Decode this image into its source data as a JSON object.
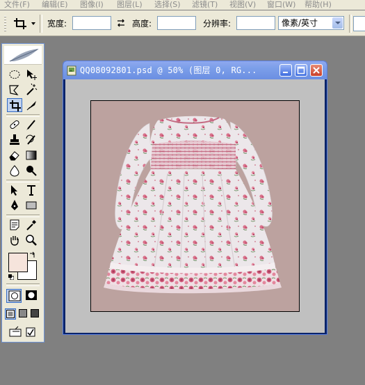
{
  "menu": [
    "文件(F)",
    "编辑(E)",
    "图像(I)",
    "图层(L)",
    "选择(S)",
    "滤镜(T)",
    "视图(V)",
    "窗口(W)",
    "帮助(H)"
  ],
  "options": {
    "width_label": "宽度:",
    "width_value": "",
    "height_label": "高度:",
    "height_value": "",
    "resolution_label": "分辨率:",
    "resolution_value": "",
    "unit_selected": "像素/英寸"
  },
  "document": {
    "title": "QQ08092801.psd @ 50% (图层 0, RG..."
  },
  "colors": {
    "foreground": "#f6e4dc",
    "background": "#ffffff",
    "canvas_bg": "#bca29f",
    "workspace": "#808080",
    "titlebar": "#7b9ee9"
  },
  "icons": {
    "toolbox": [
      "marquee-icon",
      "move-icon",
      "lasso-icon",
      "magic-wand-icon",
      "crop-icon",
      "slice-icon",
      "healing-brush-icon",
      "brush-icon",
      "clone-stamp-icon",
      "history-brush-icon",
      "eraser-icon",
      "gradient-icon",
      "blur-icon",
      "dodge-icon",
      "path-select-icon",
      "type-icon",
      "pen-icon",
      "shape-icon",
      "notes-icon",
      "eyedropper-icon",
      "hand-icon",
      "zoom-icon"
    ]
  }
}
